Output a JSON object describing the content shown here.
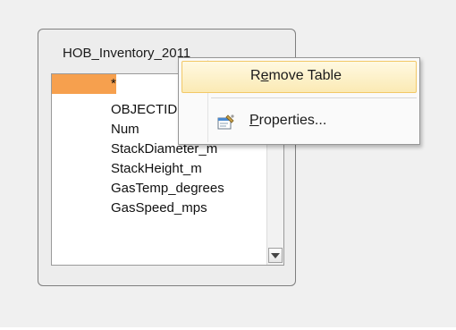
{
  "table": {
    "title": "HOB_Inventory_2011",
    "fields": [
      "*",
      "OBJECTID",
      "Num",
      "StackDiameter_m",
      "StackHeight_m",
      "GasTemp_degrees",
      "GasSpeed_mps"
    ],
    "selected_index": 0
  },
  "context_menu": {
    "items": [
      {
        "label": "Remove Table",
        "mnemonic": "e",
        "highlighted": true,
        "icon": ""
      },
      {
        "label": "Properties...",
        "mnemonic": "P",
        "highlighted": false,
        "icon": "properties-icon"
      }
    ]
  },
  "colors": {
    "selected_row": "#f6a04e",
    "menu_highlight_border": "#f2c867",
    "canvas_bg": "#f0f0f0"
  }
}
